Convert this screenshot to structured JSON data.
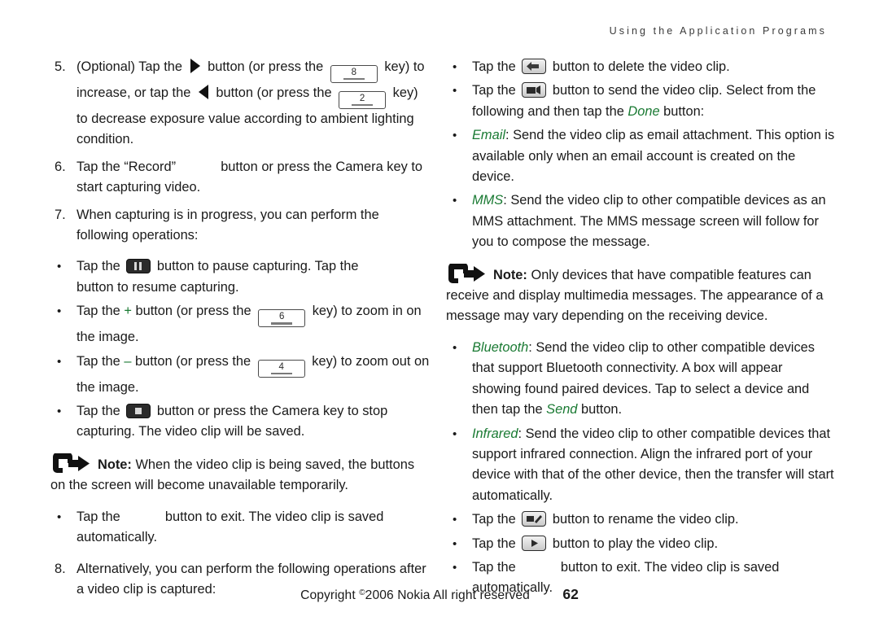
{
  "header": {
    "running_head": "Using the Application Programs"
  },
  "footer": {
    "copyright": "Copyright ©2006 Nokia All right reserved",
    "copyright_prefix": "Copyright ",
    "copyright_symbol": "©",
    "copyright_rest": "2006 Nokia All right reserved",
    "page_number": "62"
  },
  "colors": {
    "accent_green": "#1a7a33",
    "text": "#1a1a1a",
    "header_gray": "#3a3a3a"
  },
  "left_column": {
    "item5": {
      "marker": "5.",
      "t1": "(Optional) Tap the ",
      "t2": " button (or press the ",
      "key1": "8",
      "t3": " key) to increase, or tap the ",
      "t4": " button (or press the ",
      "key2": "2",
      "t5": " key) to decrease exposure value according to ambient lighting condition."
    },
    "item6": {
      "marker": "6.",
      "t1": "Tap the “Record” ",
      "t2": " button or press the Camera key to start capturing video."
    },
    "item7": {
      "marker": "7.",
      "t1": "When capturing is in progress, you can perform the following operations:"
    },
    "bullet_pause": {
      "marker": "•",
      "t1": "Tap the ",
      "t2": " button to pause capturing. Tap the ",
      "t3": " button to resume capturing."
    },
    "bullet_zoomin": {
      "marker": "•",
      "t1": "Tap the ",
      "plus": "+",
      "t2": " button (or press the ",
      "key": "6",
      "t3": " key) to zoom in on the image."
    },
    "bullet_zoomout": {
      "marker": "•",
      "t1": "Tap the ",
      "minus": "–",
      "t2": " button (or press the ",
      "key": "4",
      "t3": " key) to zoom out on the image."
    },
    "bullet_stop": {
      "marker": "•",
      "t1": "Tap the ",
      "t2": " button or press the Camera key to stop capturing. The video clip will be saved."
    },
    "note": {
      "label": "Note:",
      "text": " When the video clip is being saved, the buttons on the screen will become unavailable temporarily."
    },
    "bullet_exit": {
      "marker": "•",
      "t1": "Tap the ",
      "t2": " button to exit. The video clip is saved automatically."
    },
    "item8": {
      "marker": "8.",
      "t1": "Alternatively, you can perform the following operations after a video clip is captured:"
    }
  },
  "right_column": {
    "bullet_delete": {
      "marker": "•",
      "t1": "Tap the ",
      "t2": " button to delete the video clip."
    },
    "bullet_send": {
      "marker": "•",
      "t1": "Tap the ",
      "t2": " button to send the video clip. Select from the following and then tap the ",
      "done": "Done",
      "t3": " button:"
    },
    "bullet_email": {
      "marker": "•",
      "label": "Email",
      "t1": ": Send the video clip as email attachment. This option is available only when an email account is created on the device."
    },
    "bullet_mms": {
      "marker": "•",
      "label": "MMS",
      "t1": ": Send the video clip to other compatible devices as an MMS attachment. The MMS message screen will follow for you to compose the message."
    },
    "note": {
      "label": "Note:",
      "text": " Only devices that have compatible features can receive and display multimedia messages. The appearance of a message may vary depending on the receiving device."
    },
    "bullet_bluetooth": {
      "marker": "•",
      "label": "Bluetooth",
      "t1": ": Send the video clip to other compatible devices that support Bluetooth connectivity. A box will appear showing found paired devices. Tap to select a device and then tap the ",
      "send": "Send",
      "t2": " button."
    },
    "bullet_infrared": {
      "marker": "•",
      "label": "Infrared",
      "t1": ": Send the video clip to other compatible devices that support infrared connection. Align the infrared port of your device with that of the other device, then the transfer will start automatically."
    },
    "bullet_rename": {
      "marker": "•",
      "t1": "Tap the ",
      "t2": " button to rename the video clip."
    },
    "bullet_play": {
      "marker": "•",
      "t1": "Tap the ",
      "t2": " button to play the video clip."
    },
    "bullet_exit": {
      "marker": "•",
      "t1": "Tap the ",
      "t2": " button to exit. The video clip is saved automatically."
    }
  }
}
